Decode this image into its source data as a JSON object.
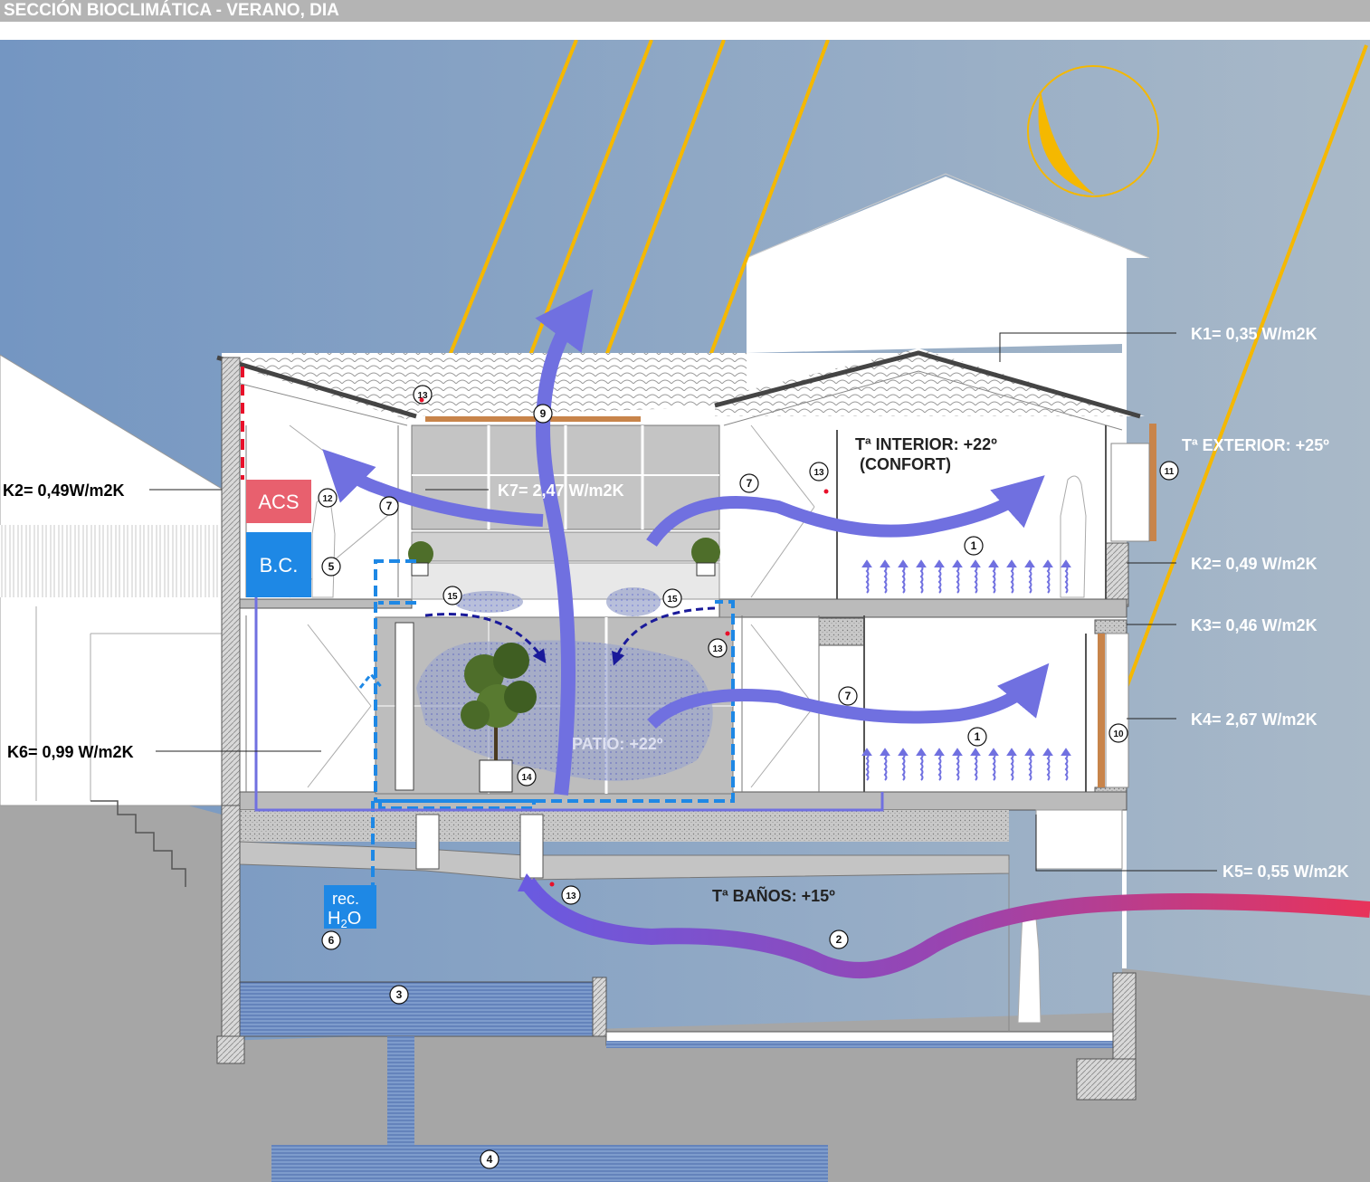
{
  "title": "SECCIÓN BIOCLIMÁTICA - VERANO, DIA",
  "boxes": {
    "acs": "ACS",
    "bc": "B.C.",
    "rec_line1": "rec.",
    "rec_line2": "H",
    "rec_sub": "2",
    "rec_line2_end": "O"
  },
  "k_labels": {
    "k1": "K1= 0,35 W/m2K",
    "k2_left": "K2= 0,49W/m2K",
    "k2_right": "K2= 0,49 W/m2K",
    "k3": "K3= 0,46 W/m2K",
    "k4": "K4= 2,67 W/m2K",
    "k5": "K5= 0,55 W/m2K",
    "k6": "K6= 0,99 W/m2K",
    "k7": "K7= 2,47 W/m2K"
  },
  "temps": {
    "interior_line1": "Tª INTERIOR: +22º",
    "interior_line2": "(CONFORT)",
    "exterior": "Tª EXTERIOR: +25º",
    "banos": "Tª BAÑOS: +15º",
    "patio": "PATIO: +22º"
  },
  "markers": [
    "1",
    "1",
    "2",
    "3",
    "4",
    "5",
    "6",
    "7",
    "7",
    "7",
    "7",
    "9",
    "10",
    "11",
    "12",
    "13",
    "13",
    "13",
    "13",
    "14",
    "15",
    "15"
  ],
  "colors": {
    "sky": "#7f9fc4",
    "sun": "#f5b800",
    "air_flow": "#7070e0",
    "warm_flow": "#e8335a",
    "water": "#1e88e5",
    "acs_box": "#e8606e",
    "bc_box": "#1e88e5",
    "ground": "#a9a9a9"
  }
}
